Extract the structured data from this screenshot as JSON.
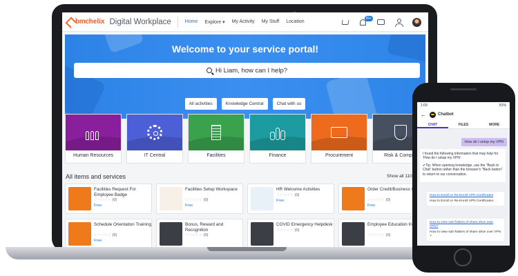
{
  "header": {
    "logo_bmc": "bmc",
    "logo_helix": "helix",
    "app_title": "Digital Workplace",
    "nav": [
      "Home",
      "Explore ▾",
      "My Activity",
      "My Stuff",
      "Location"
    ],
    "notification_count": "99+"
  },
  "banner": {
    "title": "Welcome to your service portal!",
    "search_placeholder": "Hi Liam, how can I help?",
    "buttons": [
      "All activities",
      "Knowledge Central",
      "Chat with us"
    ]
  },
  "categories": [
    {
      "label": "Human Resources",
      "color": "#8a1f9e",
      "icon": "people-icon"
    },
    {
      "label": "IT Central",
      "color": "#4c5fd6",
      "icon": "gear-icon"
    },
    {
      "label": "Facilities",
      "color": "#3aa14c",
      "icon": "building-icon"
    },
    {
      "label": "Finance",
      "color": "#1c9ca0",
      "icon": "coins-icon"
    },
    {
      "label": "Procurement",
      "color": "#ee6a1c",
      "icon": "monitor-icon"
    },
    {
      "label": "Risk & Complia",
      "color": "#475060",
      "icon": "shield-icon"
    }
  ],
  "items_section": {
    "title": "All items and services",
    "show_all": "Show all 110"
  },
  "items": [
    {
      "title": "Facilities Request For Employee Badge",
      "rating": "☆☆☆☆☆",
      "count": "(0)",
      "price": "Free",
      "thumb_color": "#ee7a1c"
    },
    {
      "title": "Facilities Setup Workspace",
      "rating": "☆☆☆☆☆",
      "count": "(0)",
      "price": "Free",
      "thumb_color": "#f6f0e6"
    },
    {
      "title": "HR Welcome Activities",
      "rating": "☆☆☆☆☆",
      "count": "(0)",
      "price": "Free",
      "thumb_color": "#e9f1f8"
    },
    {
      "title": "Order Credit/Business Cards",
      "rating": "☆☆☆☆☆",
      "count": "(0)",
      "price": "Free",
      "thumb_color": "#ee7a1c"
    },
    {
      "title": "Schedule Orientation Training",
      "rating": "☆☆☆☆☆",
      "count": "(0)",
      "price": "Free",
      "thumb_color": "#ee7a1c"
    },
    {
      "title": "Bonus, Reward and Recognition",
      "rating": "☆☆☆☆☆",
      "count": "(0)",
      "price": "",
      "thumb_color": "#3b3e45"
    },
    {
      "title": "COVID Emergency Helpdesk",
      "rating": "☆☆☆☆☆",
      "count": "(0)",
      "price": "",
      "thumb_color": "#3b3e45"
    },
    {
      "title": "Employee Education Inquiry",
      "rating": "☆☆☆☆☆",
      "count": "(0)",
      "price": "",
      "thumb_color": "#3b3e45"
    }
  ],
  "phone": {
    "time": "1:09",
    "battery": "81%",
    "chat_title": "Chatbot",
    "tabs": [
      "CHAT",
      "FILES",
      "MORE"
    ],
    "user_message": "How do I setup my VPN",
    "bot_message_1": "I found the following information that may help for 'How do I setup my VPN'.",
    "bot_message_2": "✔Tip: When opening knowledge, use the \"Back to Chat\" button rather than the browser's \"Back button\" to return to our conversation.",
    "links": [
      {
        "link": "How to Enroll or Re-Enroll VPN Certificates",
        "desc": "How to Enroll or Re-Enroll VPN Certificates."
      },
      {
        "link": "How to view sub-folders of share drive over VPN?",
        "desc": "How to view sub-folders of share drive over VPN ?"
      }
    ]
  }
}
